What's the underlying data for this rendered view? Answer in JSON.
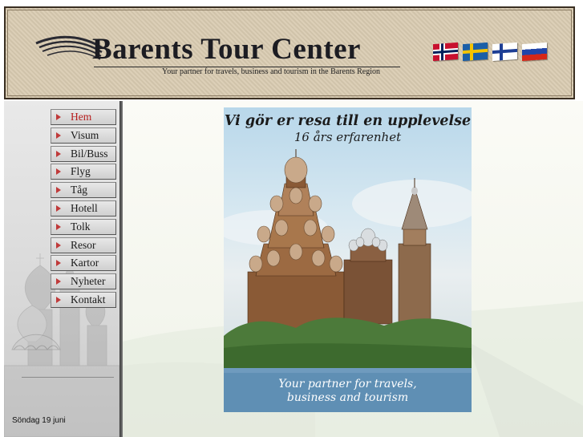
{
  "header": {
    "title": "Barents Tour Center",
    "tagline": "Your partner for travels, business and tourism in the Barents Region",
    "flags": [
      "flag-norway",
      "flag-sweden",
      "flag-finland",
      "flag-russia"
    ]
  },
  "nav": {
    "items": [
      {
        "label": "Hem",
        "active": true
      },
      {
        "label": "Visum"
      },
      {
        "label": "Bil/Buss"
      },
      {
        "label": "Flyg"
      },
      {
        "label": "Tåg"
      },
      {
        "label": "Hotell"
      },
      {
        "label": "Tolk"
      },
      {
        "label": "Resor"
      },
      {
        "label": "Kartor"
      },
      {
        "label": "Nyheter"
      },
      {
        "label": "Kontakt"
      }
    ]
  },
  "sidebar": {
    "date": "Söndag 19 juni"
  },
  "poster": {
    "headline": "Vi gör er resa till en upplevelse",
    "subline": "16 års erfarenhet",
    "caption_line1": "Your partner for travels,",
    "caption_line2": "business and tourism"
  },
  "colors": {
    "header_bg": "#d9cbb1",
    "nav_active": "#b61c1c",
    "nav_arrow": "#c03a3a",
    "sidebar_bg": "#dcdcdc"
  }
}
